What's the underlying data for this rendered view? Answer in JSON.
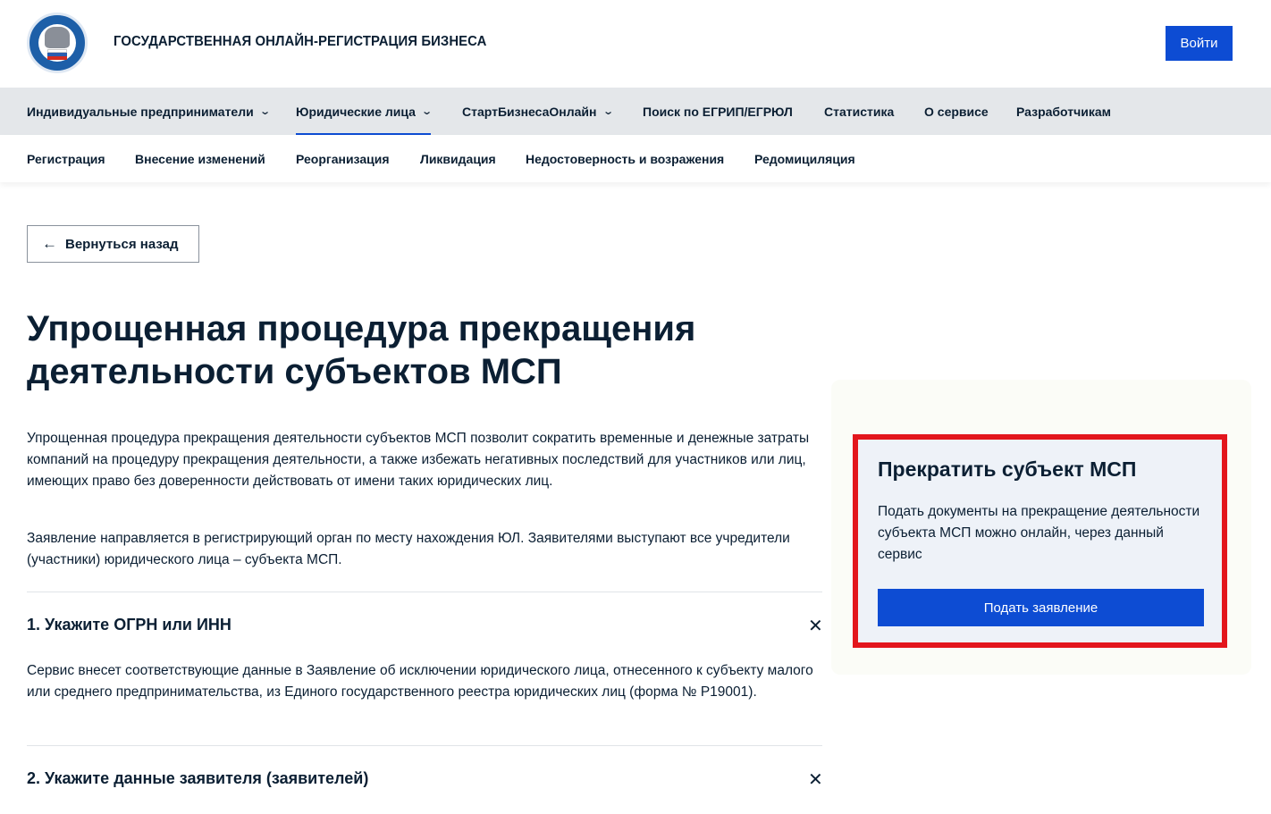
{
  "header": {
    "logo_icon": "fns-emblem-icon",
    "site_title": "ГОСУДАРСТВЕННАЯ ОНЛАЙН-РЕГИСТРАЦИЯ БИЗНЕСА",
    "login_label": "Войти",
    "accent_color": "#0d4cd3"
  },
  "main_nav": {
    "items": [
      {
        "label": "Индивидуальные предприниматели",
        "has_dropdown": true,
        "active": false
      },
      {
        "label": "Юридические лица",
        "has_dropdown": true,
        "active": true
      },
      {
        "label": "СтартБизнесаОнлайн",
        "has_dropdown": true,
        "active": false
      },
      {
        "label": "Поиск по ЕГРИП/ЕГРЮЛ",
        "has_dropdown": false,
        "active": false
      },
      {
        "label": "Статистика",
        "has_dropdown": false,
        "active": false
      },
      {
        "label": "О сервисе",
        "has_dropdown": false,
        "active": false
      },
      {
        "label": "Разработчикам",
        "has_dropdown": false,
        "active": false
      }
    ],
    "chevron_icon": "chevron-down-icon"
  },
  "sub_nav": {
    "items": [
      {
        "label": "Регистрация"
      },
      {
        "label": "Внесение изменений"
      },
      {
        "label": "Реорганизация"
      },
      {
        "label": "Ликвидация"
      },
      {
        "label": "Недостоверность и возражения"
      },
      {
        "label": "Редомициляция"
      }
    ]
  },
  "back_button": {
    "label": "Вернуться назад",
    "icon": "arrow-left-icon"
  },
  "page": {
    "title": "Упрощенная процедура прекращения деятельности субъектов МСП",
    "paragraph_1": "Упрощенная процедура прекращения деятельности субъектов МСП позволит сократить временные и денежные затраты компаний на процедуру прекращения деятельности, а также избежать негативных последствий для участников или лиц, имеющих право без доверенности действовать от имени таких юридических лиц.",
    "paragraph_2": "Заявление направляется в регистрирующий орган по месту нахождения ЮЛ. Заявителями выступают все учредители (участники) юридического лица – субъекта МСП."
  },
  "steps": [
    {
      "title": "1. Укажите ОГРН или ИНН",
      "description": "Сервис внесет соответствующие данные в Заявление об исключении юридического лица, отнесенного к субъекту малого или среднего предпринимательства, из Единого государственного реестра юридических лиц (форма № Р19001).",
      "close_icon": "close-icon"
    },
    {
      "title": "2. Укажите данные заявителя (заявителей)",
      "close_icon": "close-icon"
    }
  ],
  "side_card": {
    "title": "Прекратить субъект МСП",
    "text": "Подать документы на прекращение деятельности субъекта МСП можно онлайн, через данный сервис",
    "button_label": "Подать заявление",
    "highlight_color": "#e3161d"
  }
}
